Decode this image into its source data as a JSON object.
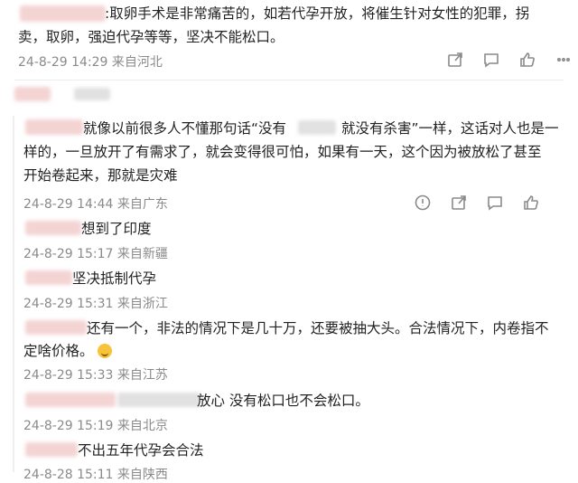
{
  "comment1": {
    "line1": ":取卵手术是非常痛苦的，如若代孕开放，将催生针对女性的犯罪，拐",
    "line2": "卖，取卵，强迫代孕等等，坚决不能松口。",
    "meta": "24-8-29 14:29 来自河北"
  },
  "comment2": {
    "line1_a": "就像以前很多人不懂那句话“没有",
    "line1_b": "就没有杀害”一样，这话对人也是一",
    "line2": "样的，一旦放开了有需求了，就会变得很可怕，如果有一天，这个因为被放松了甚至",
    "line3": "开始卷起来，那就是灾难",
    "meta": "24-8-29 14:44 来自广东"
  },
  "replies": [
    {
      "text": "想到了印度",
      "meta": "24-8-29 15:17 来自新疆"
    },
    {
      "text": "坚决抵制代孕",
      "meta": "24-8-29 15:31 来自浙江"
    },
    {
      "text": "还有一个，非法的情况下是几十万，还要被抽大头。合法情况下，内卷指不",
      "text2": "定啥价格。",
      "meta": "24-8-29 15:33 来自江苏"
    },
    {
      "text": "放心 没有松口也不会松口。",
      "meta": "24-8-29 15:19 来自北京"
    },
    {
      "text": "不出五年代孕会合法",
      "meta": "24-8-28 15:11 来自陕西"
    }
  ],
  "icons": [
    "share-icon",
    "comment-icon",
    "like-icon",
    "more-icon"
  ]
}
